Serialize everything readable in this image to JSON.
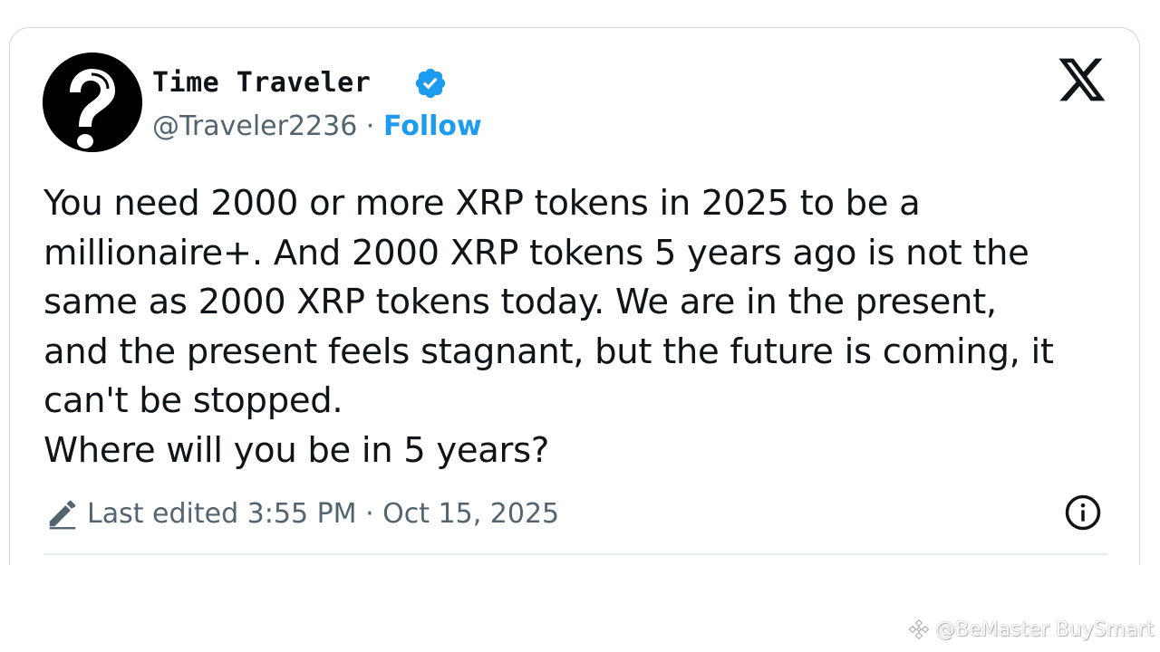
{
  "tweet": {
    "display_name": "Time Traveler",
    "handle": "@Traveler2236",
    "separator": " · ",
    "follow_label": "Follow",
    "body": "You need 2000 or more XRP tokens in 2025 to be a\nmillionaire+. And 2000 XRP tokens 5 years ago is not the\nsame as 2000 XRP tokens today. We are in the present,\nand the present feels stagnant, but the future is coming, it\ncan't be stopped.\nWhere will you be in 5 years?",
    "edited_label": "Last edited 3:55 PM · Oct 15, 2025",
    "verified": true
  },
  "icons": {
    "avatar": "question-mark-avatar",
    "verified": "verified-badge-icon",
    "platform": "x-logo-icon",
    "edit": "pencil-icon",
    "info": "info-icon"
  },
  "watermark": {
    "text": "@BeMaster BuySmart"
  },
  "colors": {
    "accent": "#1d9bf0",
    "text_primary": "#0f1419",
    "text_secondary": "#536471",
    "border": "#cfd9de"
  }
}
